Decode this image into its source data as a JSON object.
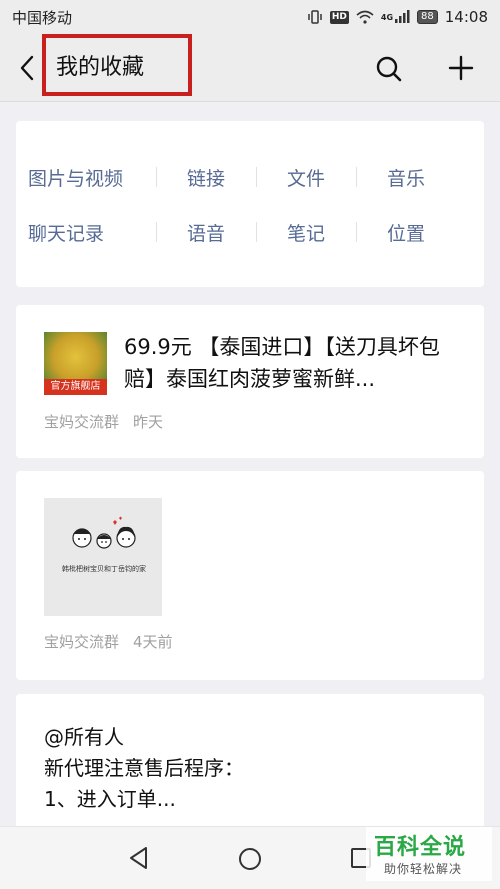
{
  "status_bar": {
    "carrier": "中国移动",
    "hd_badge": "HD",
    "network": "4G",
    "battery": "88",
    "time": "14:08"
  },
  "header": {
    "title": "我的收藏"
  },
  "categories": {
    "row1": [
      "图片与视频",
      "链接",
      "文件",
      "音乐"
    ],
    "row2": [
      "聊天记录",
      "语音",
      "笔记",
      "位置"
    ]
  },
  "favorites": [
    {
      "thumb_tag": "官方旗舰店",
      "title": "69.9元 【泰国进口】【送刀具坏包赔】泰国红肉菠萝蜜新鲜...",
      "source": "宝妈交流群",
      "time": "昨天"
    },
    {
      "thumb_caption": "韩枇杷树宝贝和丁岳钧的家",
      "source": "宝妈交流群",
      "time": "4天前"
    },
    {
      "text": "@所有人\n新代理注意售后程序：\n1、进入订单..."
    }
  ],
  "watermark": {
    "title": "百科全说",
    "subtitle": "助你轻松解决"
  },
  "colors": {
    "link_blue": "#576b95",
    "highlight_red": "#c81f1f",
    "watermark_green": "#2aa845"
  }
}
